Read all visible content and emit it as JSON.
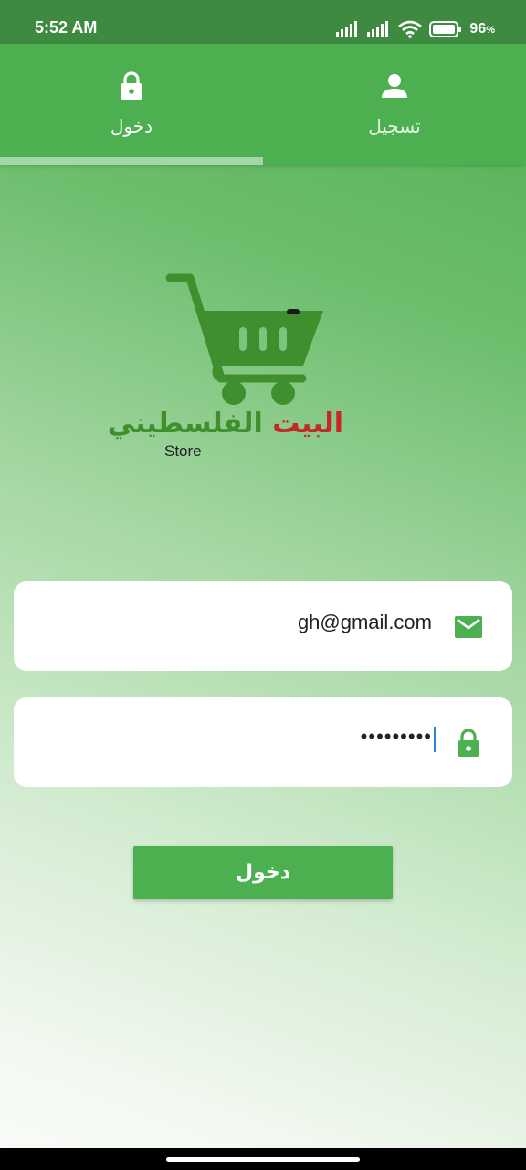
{
  "status_bar": {
    "time": "5:52 AM",
    "battery": "96",
    "battery_suffix": "%"
  },
  "tabs": [
    {
      "label": "دخول",
      "icon": "lock-icon",
      "selected": true
    },
    {
      "label": "تسجيل",
      "icon": "person-icon",
      "selected": false
    }
  ],
  "logo": {
    "word1": "البيت",
    "word2": "الفلسطيني",
    "sub": "Store"
  },
  "form": {
    "email_value": "gh@gmail.com",
    "email_icon": "mail-icon",
    "password_value": "•••••••••",
    "password_icon": "lock-icon"
  },
  "login_button": {
    "label": "دخول"
  },
  "colors": {
    "primary": "#4caf50",
    "status_bar": "#3e8a40",
    "logo_red": "#c62828",
    "logo_green": "#3f8f2f"
  }
}
